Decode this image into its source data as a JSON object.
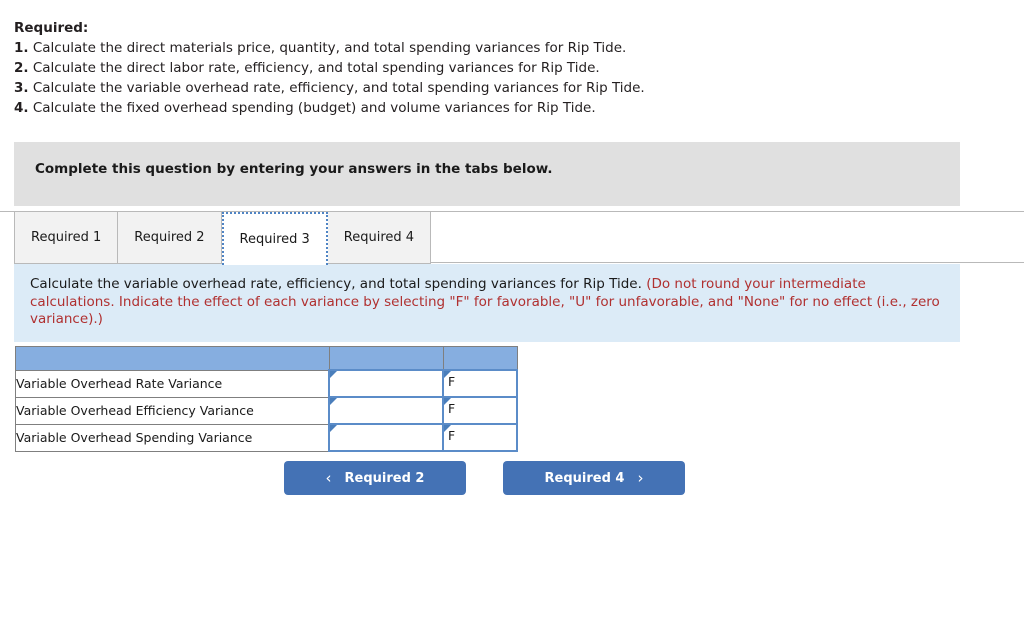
{
  "required": {
    "heading": "Required:",
    "items": [
      {
        "num": "1.",
        "text": "Calculate the direct materials price, quantity, and total spending variances for Rip Tide."
      },
      {
        "num": "2.",
        "text": "Calculate the direct labor rate, efficiency, and total spending variances for Rip Tide."
      },
      {
        "num": "3.",
        "text": "Calculate the variable overhead rate, efficiency, and total spending variances for Rip Tide."
      },
      {
        "num": "4.",
        "text": "Calculate the fixed overhead spending (budget) and volume variances for Rip Tide."
      }
    ]
  },
  "banner": {
    "text": "Complete this question by entering your answers in the tabs below."
  },
  "tabs": [
    {
      "label": "Required 1",
      "active": false
    },
    {
      "label": "Required 2",
      "active": false
    },
    {
      "label": "Required 3",
      "active": true
    },
    {
      "label": "Required 4",
      "active": false
    }
  ],
  "instruction": {
    "main": "Calculate the variable overhead rate, efficiency, and total spending variances for Rip Tide.",
    "note": "(Do not round your intermediate calculations. Indicate the effect of each variance by selecting \"F\" for favorable, \"U\" for unfavorable, and \"None\" for no effect (i.e., zero variance).)"
  },
  "table": {
    "header_label": "",
    "rows": [
      {
        "label": "Variable Overhead Rate Variance",
        "amount": "",
        "effect": "F"
      },
      {
        "label": "Variable Overhead Efficiency Variance",
        "amount": "",
        "effect": "F"
      },
      {
        "label": "Variable Overhead Spending Variance",
        "amount": "",
        "effect": "F"
      }
    ]
  },
  "nav": {
    "prev_label": "Required 2",
    "prev_chevron": "‹",
    "next_label": "Required 4",
    "next_chevron": "›"
  },
  "colors": {
    "banner_gray": "#e0e0e0",
    "instruction_blue": "#dcebf7",
    "note_red": "#b03030",
    "table_header_blue": "#86aee0",
    "cell_border_blue": "#5b8cc8",
    "button_blue": "#4472b5",
    "focus_blue": "#4f84c4"
  }
}
